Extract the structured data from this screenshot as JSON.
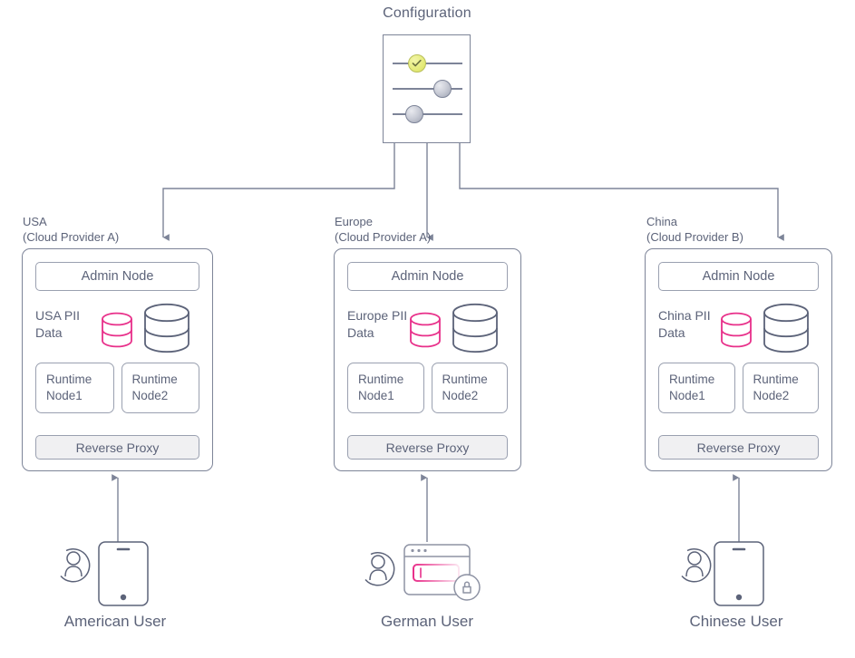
{
  "diagram": {
    "title": "Configuration",
    "config_icon": {
      "name": "settings-sliders-icon",
      "sliders": [
        {
          "knob": "check",
          "position_pct": 31
        },
        {
          "knob": "gray",
          "position_pct": 66
        },
        {
          "knob": "gray",
          "position_pct": 25
        }
      ]
    },
    "regions": [
      {
        "id": "usa",
        "label": "USA\n(Cloud Provider A)",
        "admin_node": "Admin Node",
        "pii_label": "USA PII\nData",
        "runtime_nodes": [
          "Runtime\nNode1",
          "Runtime\nNode2"
        ],
        "reverse_proxy": "Reverse Proxy"
      },
      {
        "id": "europe",
        "label": "Europe\n(Cloud Provider A)",
        "admin_node": "Admin Node",
        "pii_label": "Europe PII\nData",
        "runtime_nodes": [
          "Runtime\nNode1",
          "Runtime\nNode2"
        ],
        "reverse_proxy": "Reverse Proxy"
      },
      {
        "id": "china",
        "label": "China\n(Cloud Provider B)",
        "admin_node": "Admin Node",
        "pii_label": "China PII\nData",
        "runtime_nodes": [
          "Runtime\nNode1",
          "Runtime\nNode2"
        ],
        "reverse_proxy": "Reverse Proxy"
      }
    ],
    "users": [
      {
        "id": "american",
        "caption": "American User",
        "icon": "tablet-device-icon"
      },
      {
        "id": "german",
        "caption": "German User",
        "icon": "browser-window-lock-icon"
      },
      {
        "id": "chinese",
        "caption": "Chinese User",
        "icon": "tablet-device-icon"
      }
    ],
    "colors": {
      "line": "#7d8498",
      "text": "#5c6379",
      "pii_accent": "#e8308a",
      "proxy_fill": "#f0f0f2",
      "check_knob": "#e6ec7e"
    }
  }
}
